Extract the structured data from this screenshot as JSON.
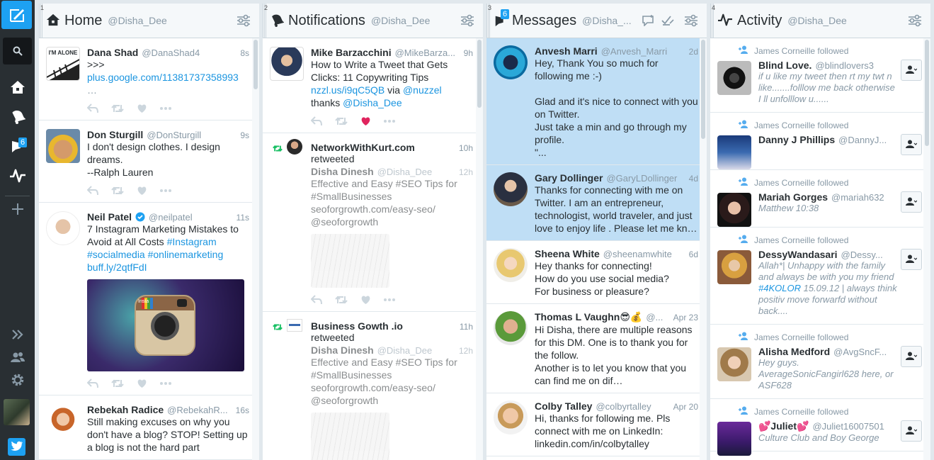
{
  "nav": {
    "messages_badge": "6",
    "icons": [
      "compose-icon",
      "search-icon",
      "home-icon",
      "notifications-icon",
      "messages-icon",
      "activity-icon",
      "add-column-icon",
      "expand-icon",
      "accounts-icon",
      "settings-icon",
      "twitter-bird-icon"
    ]
  },
  "columns": [
    {
      "number": "1",
      "title": "Home",
      "handle": "@Disha_Dee"
    },
    {
      "number": "2",
      "title": "Notifications",
      "handle": "@Disha_Dee"
    },
    {
      "number": "3",
      "title": "Messages",
      "handle": "@Disha_...",
      "badge": "6"
    },
    {
      "number": "4",
      "title": "Activity",
      "handle": "@Disha_Dee"
    }
  ],
  "colors": {
    "accent": "#1da1f2",
    "link": "#1b95e0",
    "unread": "#bfdef5",
    "like": "#e0245e",
    "retweet": "#17bf63"
  },
  "home": [
    {
      "name": "Dana Shad",
      "handle": "@DanaShad4",
      "time": "8s",
      "text": ">>>",
      "link": "plus.google.com/11381737358993",
      "extra": "…",
      "avatar_text": "I'M ALONE"
    },
    {
      "name": "Don Sturgill",
      "handle": "@DonSturgill",
      "time": "9s",
      "text": "I don't design clothes. I design dreams.\n--Ralph Lauren"
    },
    {
      "name": "Neil Patel",
      "handle": "@neilpatel",
      "time": "11s",
      "text": "7 Instagram Marketing Mistakes to Avoid at All Costs ",
      "hashtag1": "#Instagram",
      "hashtag2": "#socialmedia",
      "hashtag3": "#onlinemarketing",
      "link": "buff.ly/2qtfFdI",
      "media_label": "Insta"
    },
    {
      "name": "Rebekah Radice",
      "handle": "@RebekahR...",
      "time": "16s",
      "text": "Still making excuses on why you don't have a blog? STOP! Setting up a blog is not the hard part"
    }
  ],
  "notifications": {
    "tweet1": {
      "name": "Mike Barzacchini",
      "handle": "@MikeBarza...",
      "time": "9h",
      "text": "How to Write a Tweet that Gets Clicks: 11 Copywriting Tips",
      "link": "nzzl.us/i9qC5QB",
      "via": " via ",
      "mention1": "@nuzzel",
      "thanks": "thanks ",
      "mention2": "@Disha_Dee"
    },
    "rt1": {
      "name": "NetworkWithKurt.com",
      "time": "10h",
      "action": "retweeted",
      "orig_name": "Disha Dinesh",
      "orig_handle": "@Disha_Dee",
      "orig_time": "12h",
      "orig_text": "Effective and Easy #SEO Tips for #SmallBusinesses seoforgrowth.com/easy-seo/ @seoforgrowth"
    },
    "rt2": {
      "name": "Business Gowth .io",
      "time": "11h",
      "action": "retweeted",
      "orig_name": "Disha Dinesh",
      "orig_handle": "@Disha_Dee",
      "orig_time": "12h",
      "orig_text": "Effective and Easy #SEO Tips for #SmallBusinesses seoforgrowth.com/easy-seo/ @seoforgrowth"
    }
  },
  "messages": [
    {
      "name": "Anvesh Marri",
      "handle": "@Anvesh_Marri",
      "time": "2d",
      "text": "Hey, Thank You so much for following me :-)\n\nGlad and it's nice to connect with you on Twitter.\nJust take a min and go through my profile.\n\"...",
      "unread": true
    },
    {
      "name": "Gary Dollinger",
      "handle": "@GaryLDollinger",
      "time": "4d",
      "text": "Thanks for connecting with me on Twitter. I am an entrepreneur, technologist, world traveler, and just love to enjoy life . Please let me kn…",
      "unread": true
    },
    {
      "name": "Sheena White",
      "handle": "@sheenamwhite",
      "time": "6d",
      "text": "Hey thanks for connecting!\nHow do you use social media?\nFor business or pleasure?",
      "unread": false
    },
    {
      "name": "Thomas L Vaughn😎💰",
      "handle": "@...",
      "time": "Apr 23",
      "text": "Hi Disha, there are multiple reasons for this DM. One is to thank you for the follow.\nAnother is to let you know that you can find me on dif…",
      "unread": false
    },
    {
      "name": "Colby Talley",
      "handle": "@colbyrtalley",
      "time": "Apr 20",
      "text": "Hi, thanks for following me. Pls connect with me on LinkedIn:\nlinkedin.com/in/colbytalley",
      "unread": false
    }
  ],
  "activity": [
    {
      "follower": "James Corneille followed",
      "name": "Blind Love.",
      "handle": "@blindlovers3",
      "bio": "if u like my tweet then rt my twt n like.......folllow me back otherwise I ll unfolllow u......"
    },
    {
      "follower": "James Corneille followed",
      "name": "Danny J Phillips",
      "handle": "@DannyJ...",
      "bio": ""
    },
    {
      "follower": "James Corneille followed",
      "name": "Mariah Gorges",
      "handle": "@mariah632",
      "bio": "Matthew 10:38"
    },
    {
      "follower": "James Corneille followed",
      "name": "DessyWandasari",
      "handle": "@Dessy...",
      "bio_pre": "Allah*| Unhappy with the family and always be with you my friend ",
      "bio_tag": "#4KOLOR",
      "bio_post": " 15.09.12 | always think positiv move forwarfd without back...."
    },
    {
      "follower": "James Corneille followed",
      "name": "Alisha Medford",
      "handle": "@AvgSncF...",
      "bio": "Hey guys. AverageSonicFangirl628 here, or ASF628"
    },
    {
      "follower": "James Corneille followed",
      "name": "💕Juliet💕",
      "handle": "@Juliet16007501",
      "bio": "Culture Club and Boy George"
    }
  ]
}
